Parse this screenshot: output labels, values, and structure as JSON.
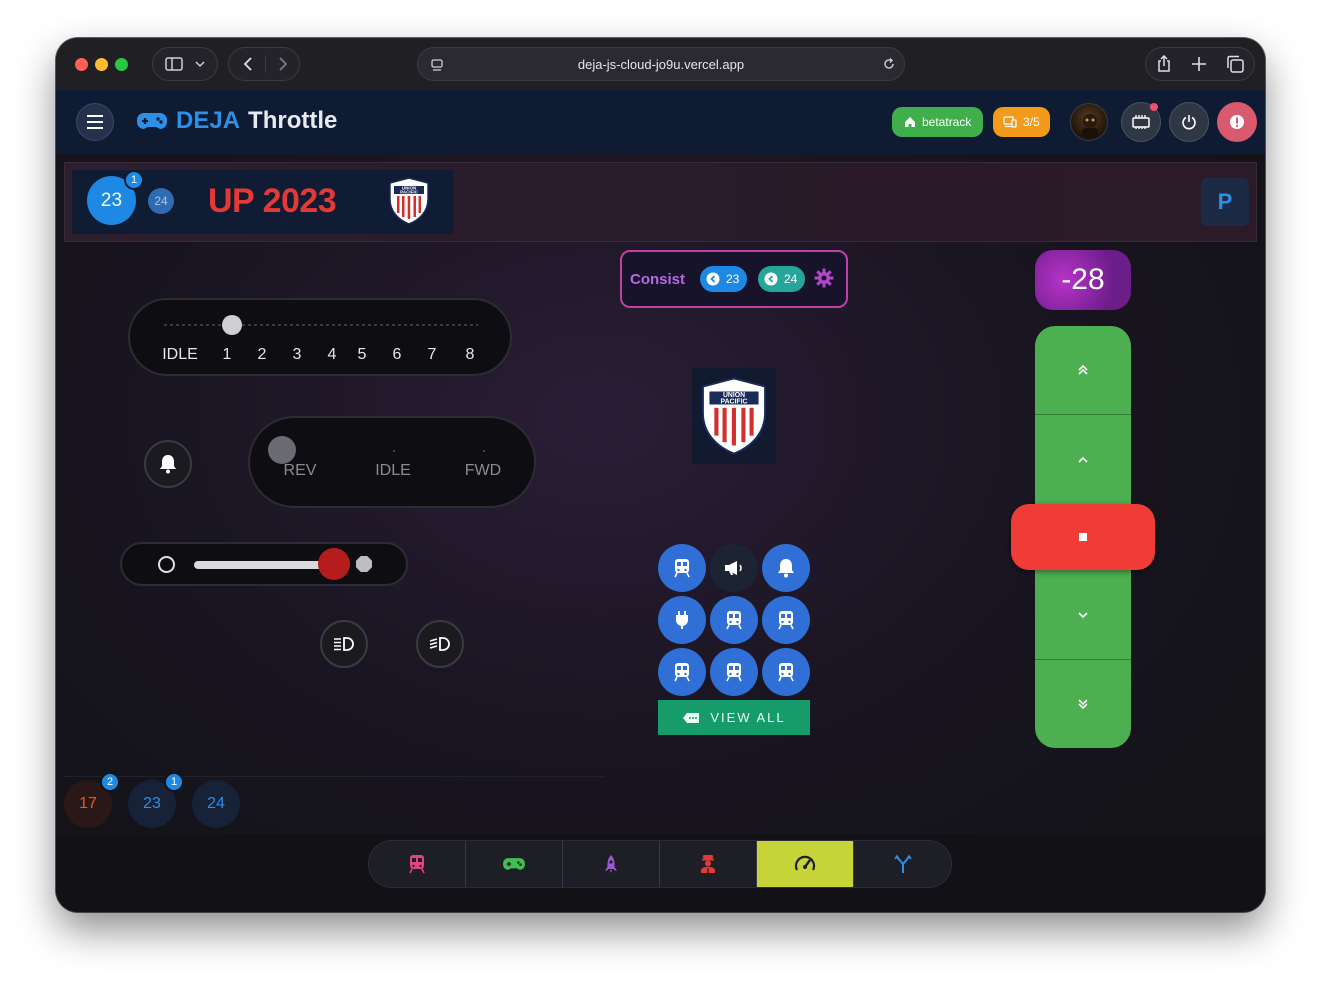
{
  "browser": {
    "url": "deja-js-cloud-jo9u.vercel.app"
  },
  "app": {
    "brand_prefix": "DEJA",
    "brand_name": "Throttle",
    "layout_chip": "betatrack",
    "slots_chip": "3/5"
  },
  "loco": {
    "address": "23",
    "address_badge": "1",
    "secondary_address": "24",
    "title": "UP 2023",
    "parking_label": "P"
  },
  "notches": {
    "labels": [
      "IDLE",
      "1",
      "2",
      "3",
      "4",
      "5",
      "6",
      "7",
      "8"
    ],
    "current": "IDLE"
  },
  "direction": {
    "labels": [
      "REV",
      "IDLE",
      "FWD"
    ]
  },
  "consist": {
    "title": "Consist",
    "members": [
      "23",
      "24"
    ]
  },
  "speed": {
    "value": "-28"
  },
  "functions": {
    "view_all": "VIEW ALL",
    "icons": [
      "train-icon",
      "horn-icon",
      "bell-icon",
      "plug-icon",
      "train-icon",
      "train-icon",
      "train-icon",
      "train-icon",
      "train-icon"
    ]
  },
  "roster": [
    {
      "address": "17",
      "badge": "2",
      "color": "#e65c1a"
    },
    {
      "address": "23",
      "badge": "1",
      "color": "#2e8fe6"
    },
    {
      "address": "24",
      "badge": "",
      "color": "#2e8fe6"
    }
  ],
  "nav": {
    "items": [
      "train-icon",
      "gamepad-icon",
      "rocket-icon",
      "conductor-icon",
      "speedometer-icon",
      "turnout-icon"
    ],
    "active": "speedometer-icon"
  },
  "colors": {
    "accent_blue": "#1e88e5",
    "speed_green": "#4caf50",
    "stop_red": "#f03c36",
    "loco_title_red": "#e53935",
    "nav_active": "#c6d43a"
  }
}
